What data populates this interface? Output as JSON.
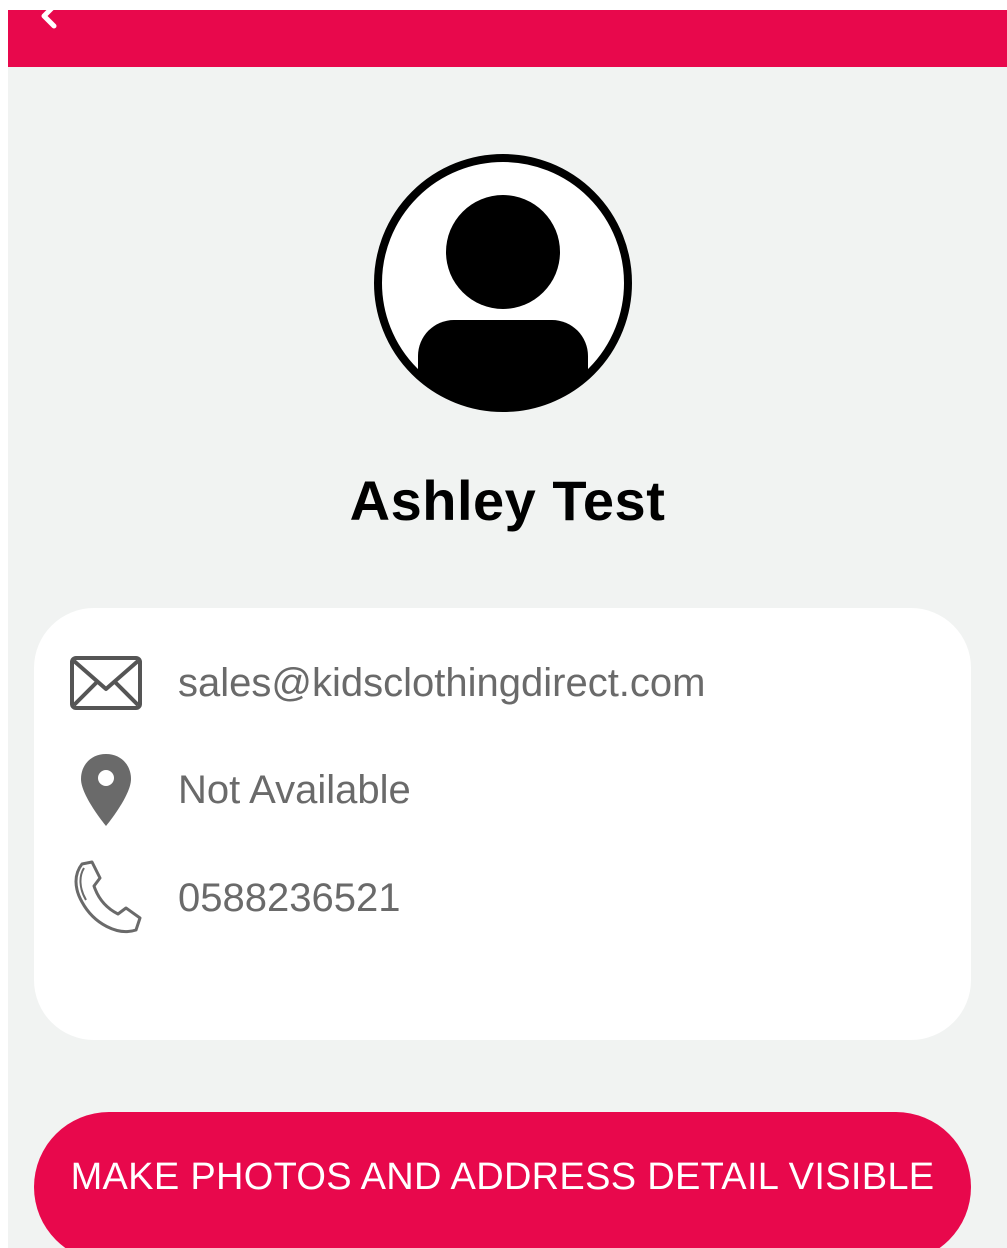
{
  "app_bar": {
    "color": "#e8084c",
    "back_icon": "chevron-left-icon"
  },
  "profile": {
    "avatar_icon": "user-circle-icon",
    "name": "Ashley Test"
  },
  "contact": {
    "email": {
      "icon": "envelope-icon",
      "value": "sales@kidsclothingdirect.com"
    },
    "location": {
      "icon": "map-pin-icon",
      "value": "Not Available"
    },
    "phone": {
      "icon": "phone-icon",
      "value": "0588236521"
    }
  },
  "actions": {
    "visibility_label": "MAKE PHOTOS AND ADDRESS DETAIL VISIBLE"
  },
  "colors": {
    "accent": "#e8084c",
    "background": "#f1f3f2",
    "card": "#ffffff",
    "text_primary": "#000000",
    "text_secondary": "#6a6a6a"
  }
}
